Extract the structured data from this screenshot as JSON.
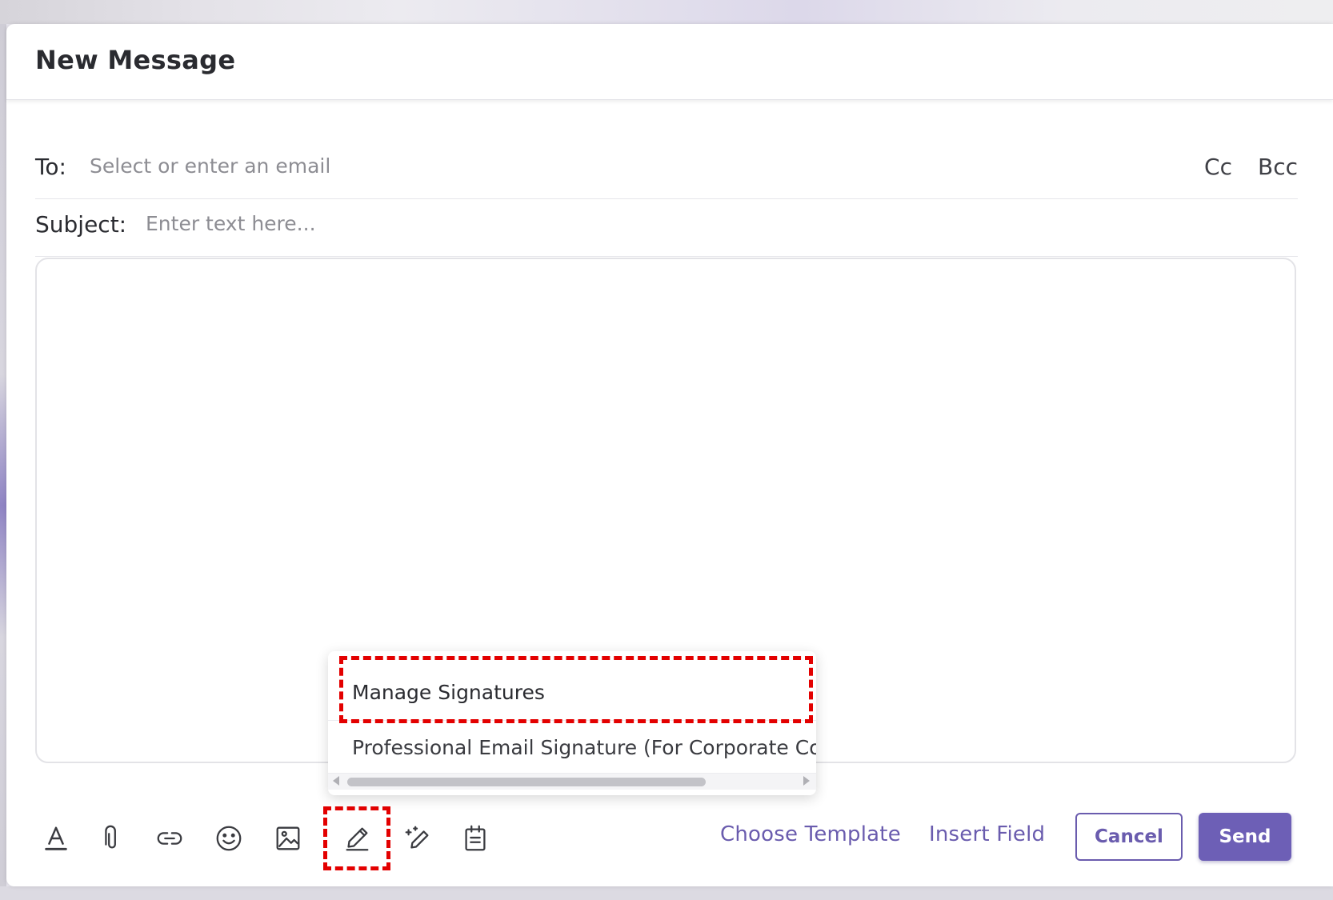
{
  "window": {
    "title": "New Message"
  },
  "compose": {
    "to_label": "To:",
    "to_placeholder": "Select or enter an email",
    "to_value": "",
    "cc_label": "Cc",
    "bcc_label": "Bcc",
    "subject_label": "Subject:",
    "subject_placeholder": "Enter text here...",
    "subject_value": "",
    "body": ""
  },
  "toolbar": {
    "icons": [
      "text-format-icon",
      "attachment-icon",
      "link-icon",
      "emoji-icon",
      "image-icon",
      "signature-icon",
      "magic-write-icon",
      "clipboard-icon"
    ],
    "choose_template_label": "Choose Template",
    "insert_field_label": "Insert Field",
    "cancel_label": "Cancel",
    "send_label": "Send"
  },
  "signature_menu": {
    "items": [
      {
        "label": "Manage Signatures"
      },
      {
        "label": "Professional Email Signature (For Corporate Cor"
      }
    ]
  },
  "colors": {
    "accent": "#6d5fb6",
    "highlight": "#e30000"
  }
}
